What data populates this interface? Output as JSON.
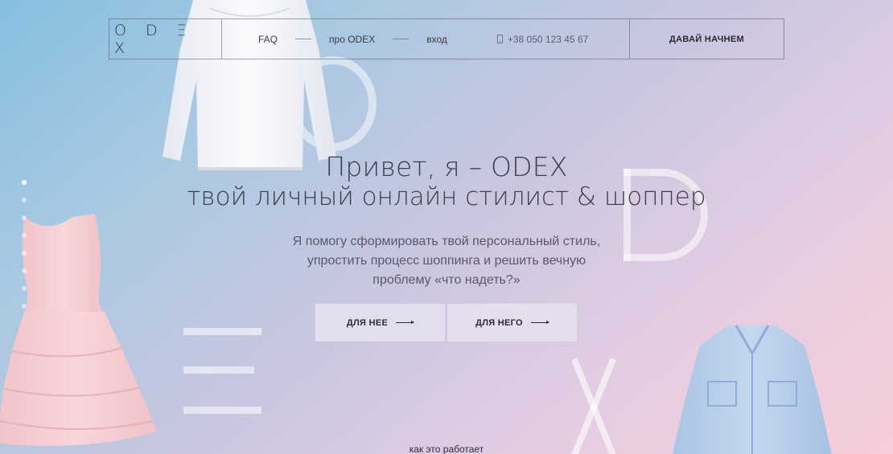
{
  "header": {
    "logo": "O D Ξ X",
    "nav": [
      {
        "label": "FAQ"
      },
      {
        "label": "про ODEX"
      },
      {
        "label": "вход"
      }
    ],
    "phone": "+38 050 123 45 67",
    "phone_icon": "phone-icon",
    "cta_label": "ДАВАЙ НАЧНЕМ"
  },
  "hero": {
    "title_line1": "Привет, я – ODEX",
    "title_line2": "твой личный онлайн стилист & шоппер",
    "subtitle": "Я помогу сформировать твой персональный стиль, упростить процесс шоппинга и решить вечную проблему «что надеть?»",
    "buttons": [
      {
        "label": "ДЛЯ НЕЕ",
        "icon": "arrow-right-icon"
      },
      {
        "label": "ДЛЯ НЕГО",
        "icon": "arrow-right-icon"
      }
    ]
  },
  "slider": {
    "total": 8,
    "active_index": 0
  },
  "footer_link": "как это работает",
  "colors": {
    "gradient_start": "#86bfe0",
    "gradient_end": "#f7cdd9",
    "text_dark": "#3e3e48",
    "button_bg": "#e6e2ee"
  }
}
